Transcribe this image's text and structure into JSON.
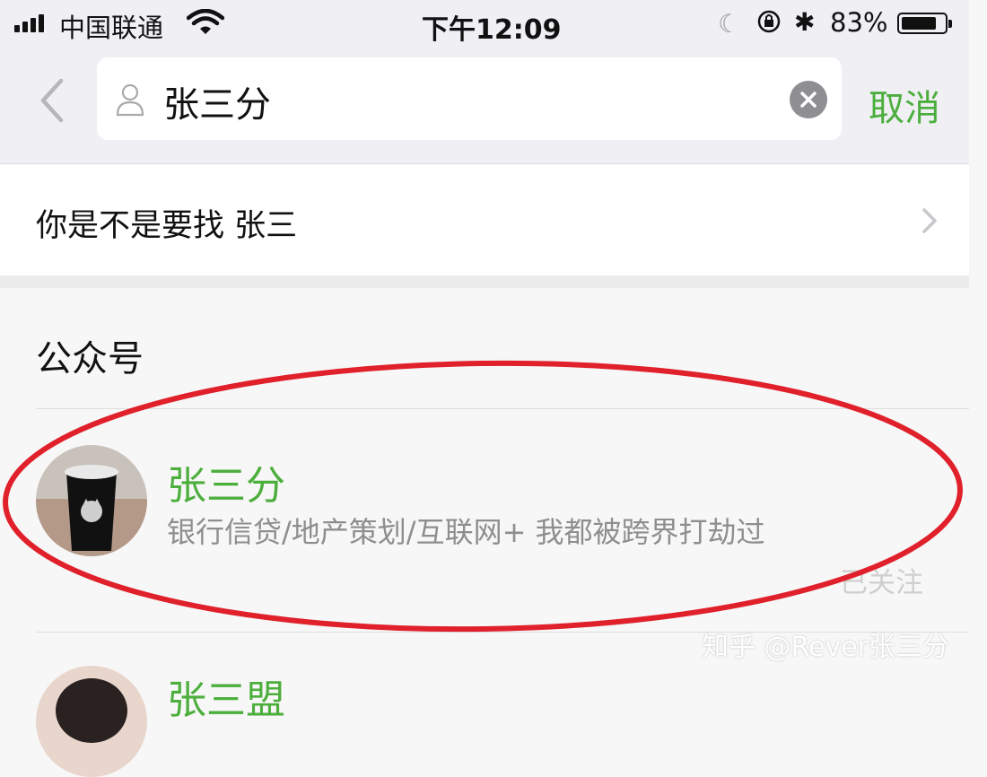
{
  "status_bar": {
    "carrier": "中国联通",
    "time": "下午12:09",
    "battery_percent": "83%",
    "battery_level": 0.83,
    "icons": [
      "signal-icon",
      "wifi-icon",
      "moon-icon",
      "orientation-lock-icon",
      "bluetooth-icon",
      "battery-icon"
    ]
  },
  "search": {
    "query": "张三分",
    "cancel_label": "取消"
  },
  "suggestion": {
    "text": "你是不是要找 张三"
  },
  "section": {
    "title": "公众号",
    "results": [
      {
        "name": "张三分",
        "description": "银行信贷/地产策划/互联网+ 我都被跨界打劫过",
        "status": "已关注"
      },
      {
        "name": "张三盟"
      }
    ]
  },
  "watermark": "知乎 @Rever张三分",
  "colors": {
    "accent_green": "#4cae3c",
    "highlight_red": "#e0202a",
    "background": "#f7f7f7"
  }
}
